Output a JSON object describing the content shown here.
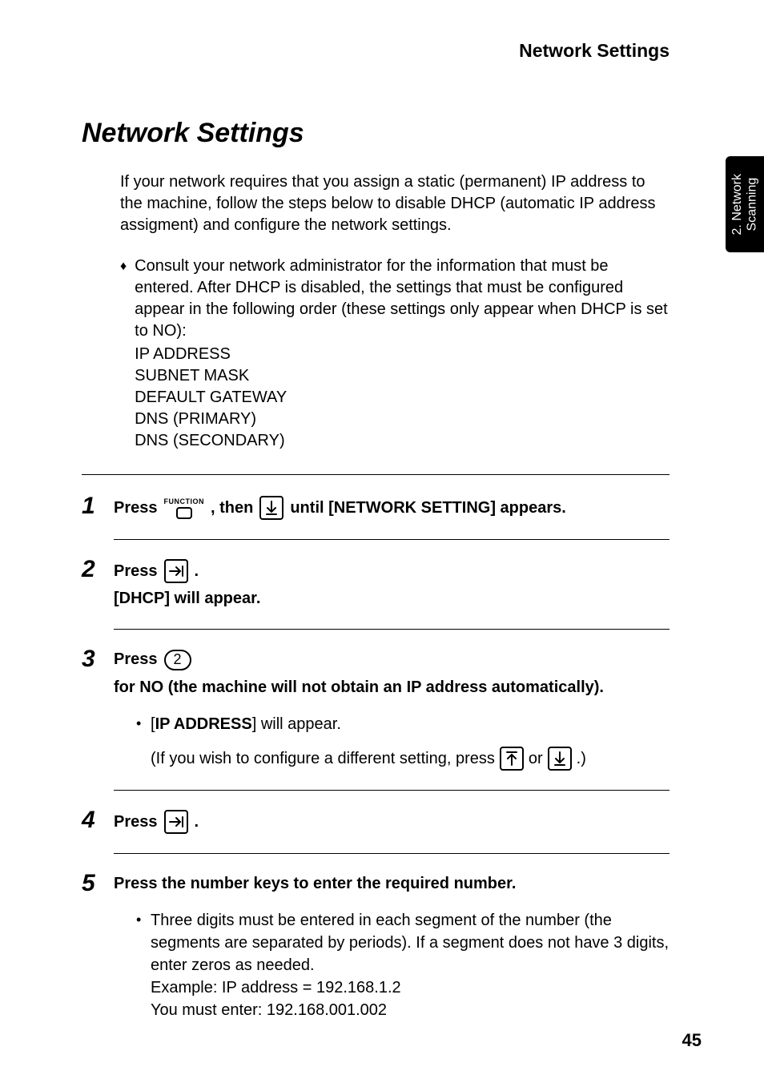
{
  "header": {
    "running_title": "Network Settings"
  },
  "title": "Network Settings",
  "intro": "If your network requires that you assign a static (permanent) IP address to the machine, follow the steps below to disable DHCP (automatic IP address assigment) and configure the network settings.",
  "note": {
    "lead": "Consult your network administrator for the information that must be entered. After DHCP is disabled, the settings that must be configured appear in the following order (these settings only appear when DHCP is set to NO):",
    "items": [
      "IP ADDRESS",
      "SUBNET MASK",
      "DEFAULT GATEWAY",
      "DNS (PRIMARY)",
      "DNS (SECONDARY)"
    ]
  },
  "steps": {
    "s1": {
      "num": "1",
      "press": "Press",
      "func_label": "FUNCTION",
      "then": ", then",
      "until": "until [NETWORK SETTING] appears."
    },
    "s2": {
      "num": "2",
      "press": "Press",
      "dot": ".",
      "line2": "[DHCP] will appear."
    },
    "s3": {
      "num": "3",
      "press": "Press",
      "key": "2",
      "rest": "for NO (the machine will not obtain an IP address automatically).",
      "bullet_a": "[",
      "bullet_b": "IP ADDRESS",
      "bullet_c": "] will appear.",
      "paren_a": "(If you wish to configure a different setting, press",
      "paren_or": "or",
      "paren_end": ".)"
    },
    "s4": {
      "num": "4",
      "press": "Press",
      "dot": "."
    },
    "s5": {
      "num": "5",
      "line": "Press the number keys to enter the required number.",
      "bullet1": "Three digits must be entered in each segment of the number (the segments are separated by periods). If a segment does not have 3 digits, enter zeros as needed.",
      "bullet2": "Example: IP address = 192.168.1.2",
      "bullet3": "You must enter: 192.168.001.002"
    }
  },
  "tab": {
    "label": "2. Network\nScanning"
  },
  "page_number": "45"
}
